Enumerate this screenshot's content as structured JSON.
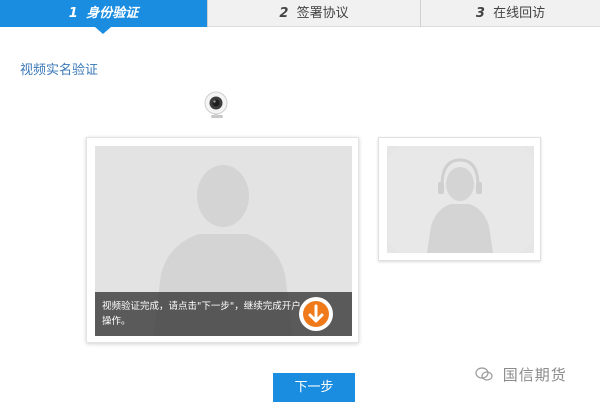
{
  "steps": [
    {
      "number": "1",
      "label": "身份验证",
      "active": true
    },
    {
      "number": "2",
      "label": "签署协议",
      "active": false
    },
    {
      "number": "3",
      "label": "在线回访",
      "active": false
    }
  ],
  "section_title": "视频实名验证",
  "video": {
    "overlay_text": "视频验证完成，请点击\"下一步\"，继续完成开户操作。",
    "download_icon": "download-arrow-icon"
  },
  "next_button": "下一步",
  "watermark": "国信期货",
  "colors": {
    "accent": "#1a8de0",
    "download_arrow": "#f07a1a"
  }
}
